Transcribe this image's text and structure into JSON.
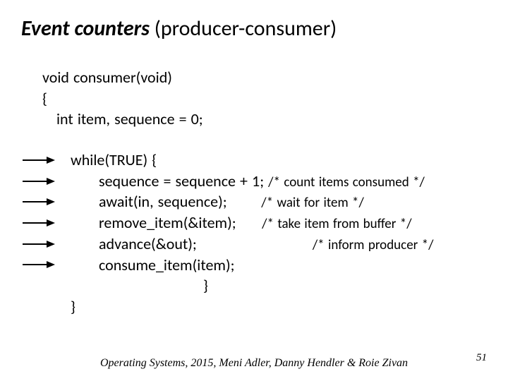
{
  "title": {
    "bold": "Event counters",
    "rest": " (producer-consumer)"
  },
  "code": {
    "sig": "void consumer(void)",
    "open": "{",
    "decl": "int  item, sequence = 0;",
    "while": "while(TRUE) {",
    "l1": "sequence = sequence + 1;",
    "c1": "/* count items consumed */",
    "l2": "await(in, sequence);",
    "c2": "/* wait for item */",
    "l3": "remove_item(&item);",
    "c3": "/* take item from buffer */",
    "l4": "advance(&out);",
    "c4": "/* inform producer */",
    "l5": "consume_item(item);",
    "closeInner": "}",
    "closeOuter": "}"
  },
  "footer": "Operating Systems, 2015, Meni Adler, Danny Hendler & Roie Zivan",
  "pagenum": "51"
}
